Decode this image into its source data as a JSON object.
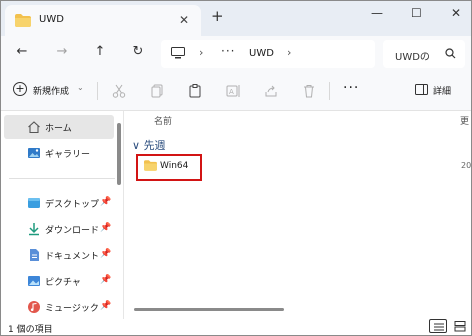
{
  "window": {
    "tab_title": "UWD",
    "new_tab_symbol": "+",
    "close_symbol": "✕",
    "minimize_symbol": "—",
    "maximize_symbol": "☐"
  },
  "address_bar": {
    "overflow": "···",
    "crumb": "UWD",
    "separator": "›"
  },
  "search": {
    "text": "UWDの"
  },
  "command_bar": {
    "new_label": "新規作成",
    "new_caret": "⌄",
    "more": "···",
    "details_label": "詳細"
  },
  "sidebar": {
    "items": [
      {
        "label": "ホーム",
        "icon": "home-icon",
        "selected": true
      },
      {
        "label": "ギャラリー",
        "icon": "gallery-icon"
      },
      {
        "label": "デスクトップ",
        "icon": "desktop-folder-icon",
        "pinned": true
      },
      {
        "label": "ダウンロード",
        "icon": "download-icon",
        "pinned": true
      },
      {
        "label": "ドキュメント",
        "icon": "document-icon",
        "pinned": true
      },
      {
        "label": "ピクチャ",
        "icon": "picture-icon",
        "pinned": true
      },
      {
        "label": "ミュージック",
        "icon": "music-icon",
        "pinned": true
      }
    ],
    "pin_symbol": "📌"
  },
  "content": {
    "column_name": "名前",
    "column_date": "更",
    "group_label": "先週",
    "group_chevron": "∨",
    "files": [
      {
        "name": "Win64",
        "date": "20",
        "icon": "folder-icon"
      }
    ]
  },
  "status_bar": {
    "item_count": "1 個の項目"
  },
  "colors": {
    "folder": "#f2c14e",
    "highlight_border": "#d21414",
    "group_text": "#2b4d7e",
    "title_bar": "#e8edf4"
  }
}
